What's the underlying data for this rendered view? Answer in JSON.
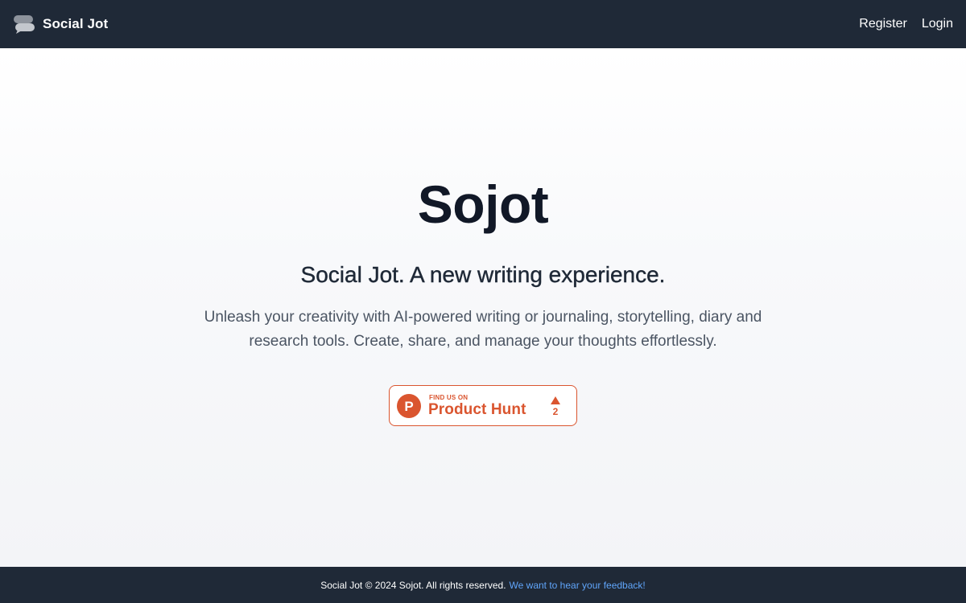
{
  "navbar": {
    "brand_icon": "chat-bubbles-icon",
    "brand_name": "Social Jot",
    "links": {
      "register": "Register",
      "login": "Login"
    }
  },
  "hero": {
    "title": "Sojot",
    "subtitle": "Social Jot. A new writing experience.",
    "description": "Unleash your creativity with AI-powered writing or journaling, storytelling, diary and research tools. Create, share, and manage your thoughts effortlessly."
  },
  "product_hunt": {
    "logo_icon": "product-hunt-logo-icon",
    "logo_letter": "P",
    "find_text": "FIND US ON",
    "name": "Product Hunt",
    "upvote_icon": "upvote-triangle-icon",
    "count": "2",
    "accent": "#da552f"
  },
  "footer": {
    "text": "Social Jot © 2024 Sojot. All rights reserved.",
    "feedback_link": "We want to hear your feedback!"
  },
  "colors": {
    "nav_bg": "#1f2937",
    "footer_bg": "#1f2937",
    "title": "#111827",
    "link": "#60a5fa"
  }
}
